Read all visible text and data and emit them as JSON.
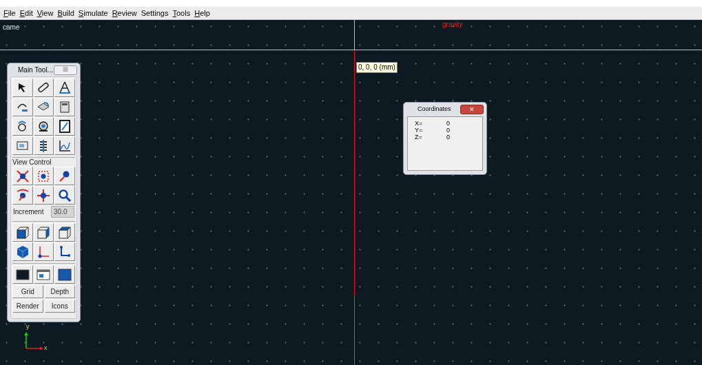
{
  "menu_bar": [
    {
      "label": "File",
      "underline_first": true
    },
    {
      "label": "Edit",
      "underline_first": true
    },
    {
      "label": "View",
      "underline_first": true
    },
    {
      "label": "Build",
      "underline_first": true
    },
    {
      "label": "Simulate",
      "underline_first": true
    },
    {
      "label": "Review",
      "underline_first": true
    },
    {
      "label": "Settings",
      "underline_first": false
    },
    {
      "label": "Tools",
      "underline_first": true
    },
    {
      "label": "Help",
      "underline_first": true
    }
  ],
  "canvas": {
    "corner_label": "came",
    "top_label": "gravity",
    "origin_tooltip": "0, 0, 0 (mm)",
    "axis_labels": [
      "y",
      "x"
    ]
  },
  "main_toolbox": {
    "title": "Main Tool...",
    "close": "☒",
    "section": "View Control",
    "increment": {
      "label": "Increment",
      "value": "30.0"
    },
    "buttons": [
      [
        "Grid",
        "Depth"
      ],
      [
        "Render",
        "Icons"
      ]
    ]
  },
  "coordinates_dialog": {
    "title": "Coordinates",
    "close": "✕",
    "rows": [
      {
        "label": "X=",
        "value": "0"
      },
      {
        "label": "Y=",
        "value": "0"
      },
      {
        "label": "Z=",
        "value": "0"
      }
    ]
  }
}
